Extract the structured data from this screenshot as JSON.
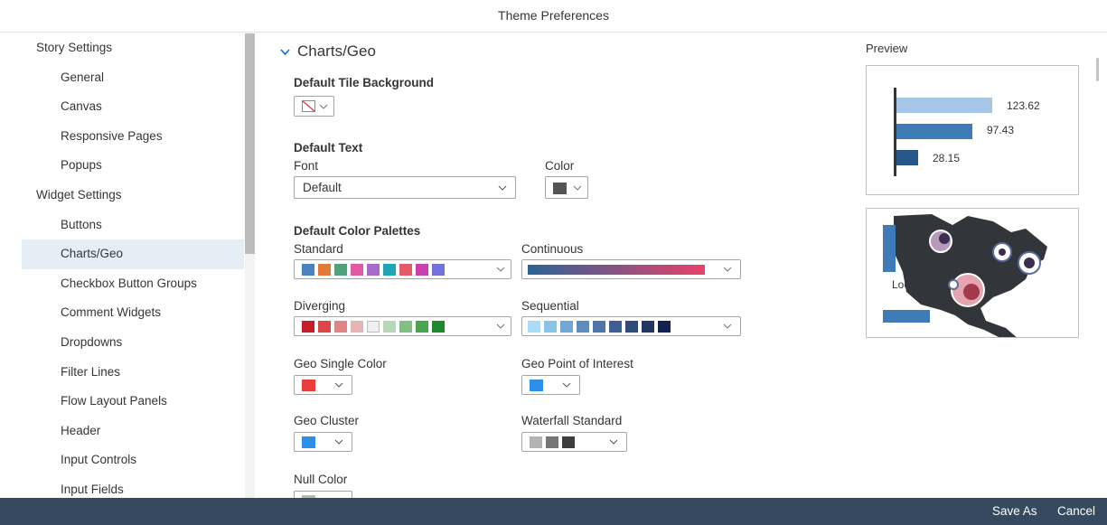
{
  "title": "Theme Preferences",
  "sidebar": {
    "items": [
      {
        "label": "Story Settings",
        "group": true
      },
      {
        "label": "General"
      },
      {
        "label": "Canvas"
      },
      {
        "label": "Responsive Pages"
      },
      {
        "label": "Popups"
      },
      {
        "label": "Widget Settings",
        "group": true
      },
      {
        "label": "Buttons"
      },
      {
        "label": "Charts/Geo",
        "selected": true
      },
      {
        "label": "Checkbox Button Groups"
      },
      {
        "label": "Comment Widgets"
      },
      {
        "label": "Dropdowns"
      },
      {
        "label": "Filter Lines"
      },
      {
        "label": "Flow Layout Panels"
      },
      {
        "label": "Header"
      },
      {
        "label": "Input Controls"
      },
      {
        "label": "Input Fields"
      }
    ]
  },
  "main": {
    "section_title": "Charts/Geo",
    "tile_background": {
      "heading": "Default Tile Background"
    },
    "default_text": {
      "heading": "Default Text",
      "font_label": "Font",
      "font_value": "Default",
      "color_label": "Color",
      "color": "#545454"
    },
    "palettes": {
      "heading": "Default Color Palettes",
      "standard": {
        "label": "Standard",
        "colors": [
          "#4a81c4",
          "#e07a38",
          "#4fa27a",
          "#e05aa5",
          "#a66cc9",
          "#1fa5b5",
          "#e35a68",
          "#c941b0",
          "#7272d8"
        ]
      },
      "continuous": {
        "label": "Continuous",
        "from": "#2b6498",
        "to": "#e8426a"
      },
      "diverging": {
        "label": "Diverging",
        "colors": [
          "#c51d2a",
          "#dc4848",
          "#e08585",
          "#e6b6b6",
          "#f0f0f0",
          "#b7d8b7",
          "#82bf82",
          "#4aa64a",
          "#1f8a2c"
        ]
      },
      "sequential": {
        "label": "Sequential",
        "colors": [
          "#a9dcf7",
          "#88c4e8",
          "#6fa8d6",
          "#5c8dbf",
          "#4d75a8",
          "#3e5f91",
          "#304a7b",
          "#223565",
          "#142150"
        ]
      }
    },
    "geo_single": {
      "label": "Geo Single Color",
      "color": "#e83e3e"
    },
    "geo_poi": {
      "label": "Geo Point of Interest",
      "color": "#2b8fe8"
    },
    "geo_cluster": {
      "label": "Geo Cluster",
      "color": "#2b8fe8"
    },
    "waterfall": {
      "label": "Waterfall Standard",
      "colors": [
        "#b3b3b3",
        "#767676",
        "#3d3d3d"
      ]
    },
    "null_color": {
      "label": "Null Color",
      "color": "#b8b8b8"
    }
  },
  "preview": {
    "label": "Preview",
    "bars": {
      "values": [
        123.62,
        97.43,
        28.15
      ],
      "labels": [
        "123.62",
        "97.43",
        "28.15"
      ],
      "colors": [
        "#a7c5e6",
        "#3e7cb8",
        "#27578a"
      ],
      "max": 123.62
    },
    "map": {
      "location_label": "Location"
    }
  },
  "footer": {
    "save_as": "Save As",
    "cancel": "Cancel"
  }
}
